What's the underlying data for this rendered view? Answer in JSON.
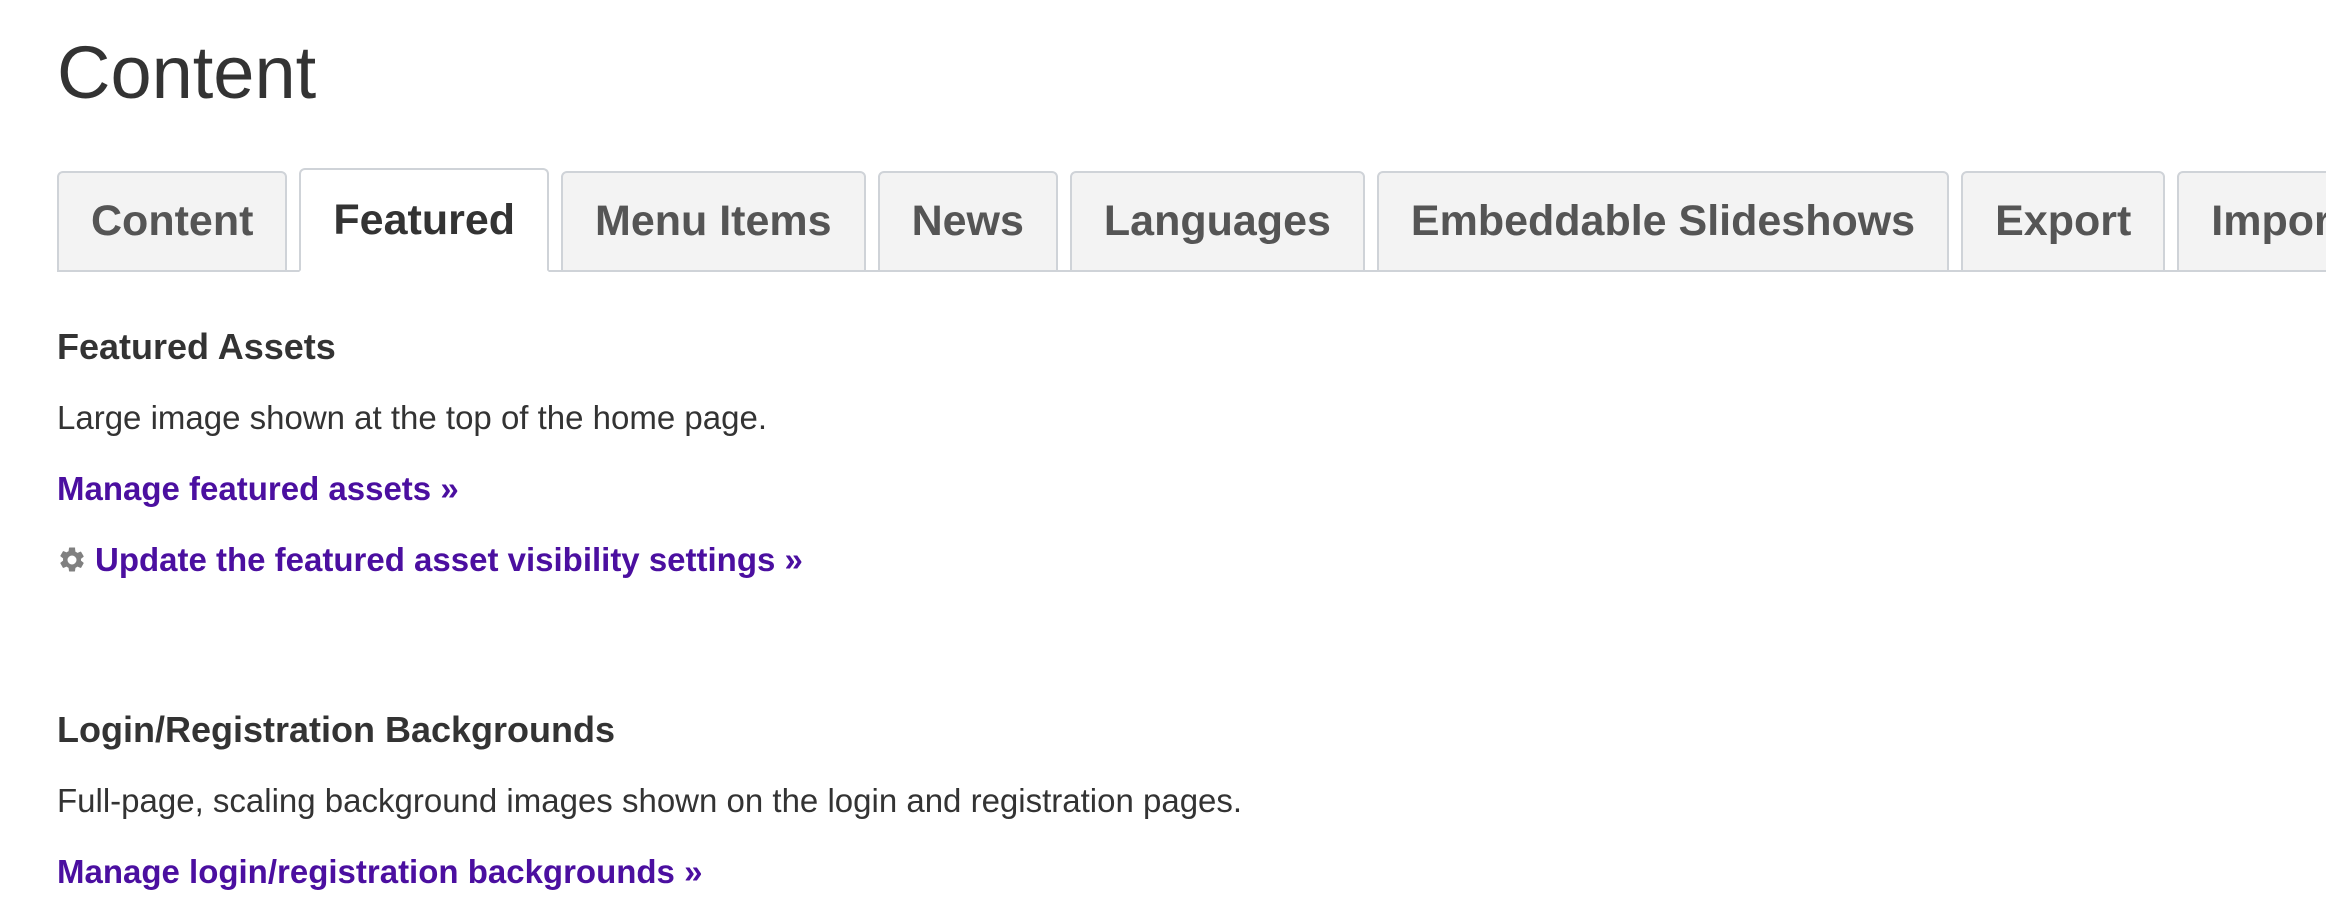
{
  "page": {
    "title": "Content"
  },
  "tabs": [
    {
      "label": "Content",
      "active": false
    },
    {
      "label": "Featured",
      "active": true
    },
    {
      "label": "Menu Items",
      "active": false
    },
    {
      "label": "News",
      "active": false
    },
    {
      "label": "Languages",
      "active": false
    },
    {
      "label": "Embeddable Slideshows",
      "active": false
    },
    {
      "label": "Export",
      "active": false
    },
    {
      "label": "Import",
      "active": false
    }
  ],
  "featured_assets": {
    "heading": "Featured Assets",
    "description": "Large image shown at the top of the home page.",
    "manage_link": "Manage featured assets »",
    "visibility_link": "Update the featured asset visibility settings »",
    "visibility_icon": "gear-icon"
  },
  "login_backgrounds": {
    "heading": "Login/Registration Backgrounds",
    "description": "Full-page, scaling background images shown on the login and registration pages.",
    "manage_link": "Manage login/registration backgrounds »"
  },
  "colors": {
    "link": "#4b0fa0",
    "text": "#333333",
    "tab_bg": "#f3f3f3",
    "tab_border": "#cfd3d8"
  }
}
